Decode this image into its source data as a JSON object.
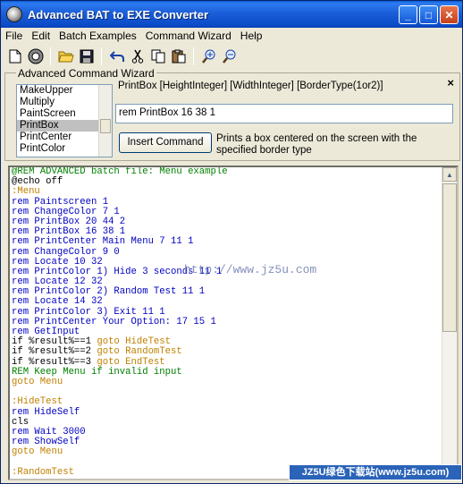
{
  "window": {
    "title": "Advanced BAT to EXE Converter"
  },
  "titlebar_buttons": {
    "minimize": "_",
    "maximize": "□",
    "close": "✕"
  },
  "menu": [
    "File",
    "Edit",
    "Batch Examples",
    "Command Wizard",
    "Help"
  ],
  "toolbar": {
    "icons": [
      "new-file-icon",
      "compile-icon",
      "open-folder-icon",
      "save-icon",
      "undo-icon",
      "cut-icon",
      "copy-icon",
      "paste-icon",
      "zoom-in-icon",
      "zoom-out-icon"
    ]
  },
  "wizard": {
    "title": "Advanced Command Wizard",
    "close": "×",
    "list": [
      "MakeUpper",
      "Multiply",
      "PaintScreen",
      "PrintBox",
      "PrintCenter",
      "PrintColor"
    ],
    "selected": "PrintBox",
    "syntax": "PrintBox  [HeightInteger]  [WidthInteger]  [BorderType(1or2)]",
    "input_value": "rem PrintBox 16 38 1",
    "insert_label": "Insert Command",
    "description": "Prints a box centered on the screen with the specified border type"
  },
  "colors": {
    "comment": "#008000",
    "label": "#c08000",
    "rem": "#0000c0",
    "plain": "#000000",
    "goto": "#c08000"
  },
  "code": [
    {
      "text": "@REM ADVANCED batch file: Menu example",
      "kind": "comment"
    },
    {
      "text": "@echo off",
      "kind": "plain"
    },
    {
      "text": ":Menu",
      "kind": "label"
    },
    {
      "text": "rem Paintscreen 1",
      "kind": "rem"
    },
    {
      "text": "rem ChangeColor 7 1",
      "kind": "rem"
    },
    {
      "text": "rem PrintBox 20 44 2",
      "kind": "rem"
    },
    {
      "text": "rem PrintBox 16 38 1",
      "kind": "rem"
    },
    {
      "text": "rem PrintCenter Main Menu 7 11 1",
      "kind": "rem"
    },
    {
      "text": "rem ChangeColor 9 0",
      "kind": "rem"
    },
    {
      "text": "rem Locate 10 32",
      "kind": "rem"
    },
    {
      "text": "rem PrintColor 1) Hide 3 seconds 11 1",
      "kind": "rem"
    },
    {
      "text": "rem Locate 12 32",
      "kind": "rem"
    },
    {
      "text": "rem PrintColor 2) Random Test 11 1",
      "kind": "rem"
    },
    {
      "text": "rem Locate 14 32",
      "kind": "rem"
    },
    {
      "text": "rem PrintColor 3) Exit 11 1",
      "kind": "rem"
    },
    {
      "text": "rem PrintCenter Your Option: 17 15 1",
      "kind": "rem"
    },
    {
      "text": "rem GetInput",
      "kind": "rem"
    },
    {
      "text": "if %result%==1 ",
      "kind": "plain",
      "tail": "goto HideTest"
    },
    {
      "text": "if %result%==2 ",
      "kind": "plain",
      "tail": "goto RandomTest"
    },
    {
      "text": "if %result%==3 ",
      "kind": "plain",
      "tail": "goto EndTest"
    },
    {
      "text": "REM Keep Menu if invalid input",
      "kind": "comment"
    },
    {
      "text": "goto Menu",
      "kind": "goto"
    },
    {
      "text": "",
      "kind": "plain"
    },
    {
      "text": ":HideTest",
      "kind": "label"
    },
    {
      "text": "rem HideSelf",
      "kind": "rem"
    },
    {
      "text": "cls",
      "kind": "plain"
    },
    {
      "text": "rem Wait 3000",
      "kind": "rem"
    },
    {
      "text": "rem ShowSelf",
      "kind": "rem"
    },
    {
      "text": "goto Menu",
      "kind": "goto"
    },
    {
      "text": "",
      "kind": "plain"
    },
    {
      "text": ":RandomTest",
      "kind": "label"
    }
  ],
  "watermark": "http://www.jz5u.com",
  "badge": "JZ5U绿色下载站(www.jz5u.com)"
}
